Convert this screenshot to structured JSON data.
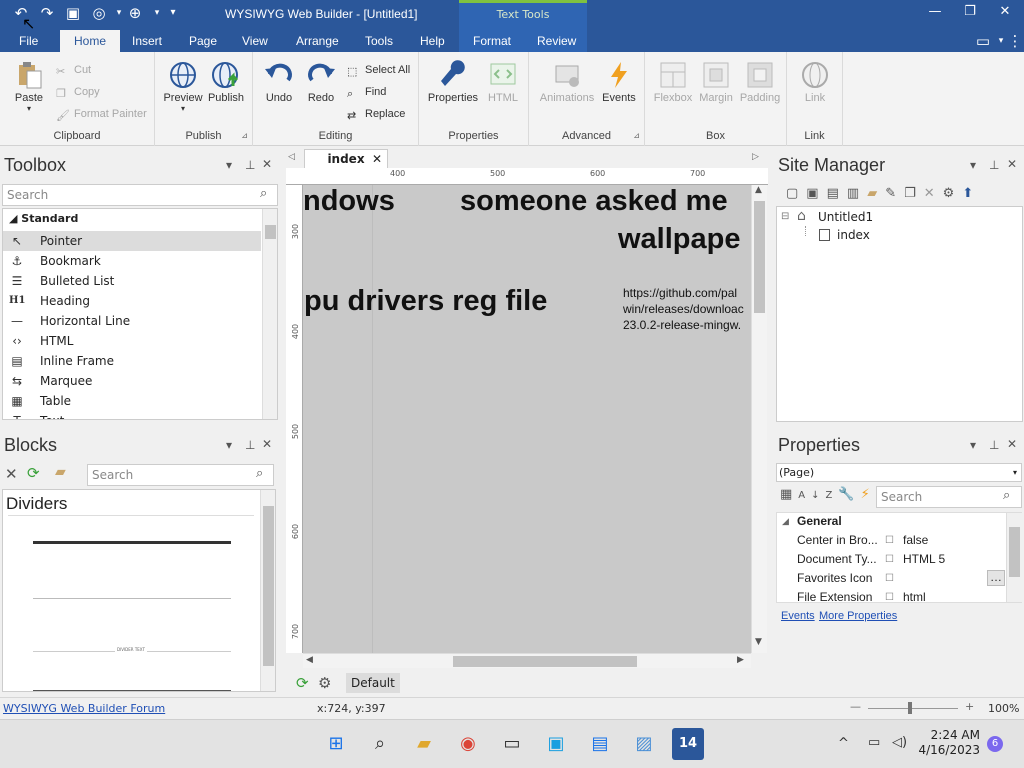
{
  "window": {
    "title": "WYSIWYG Web Builder - [Untitled1]",
    "context_tab": "Text Tools"
  },
  "tabs": [
    "File",
    "Home",
    "Insert",
    "Page",
    "View",
    "Arrange",
    "Tools",
    "Help",
    "Format",
    "Review"
  ],
  "ribbon": {
    "clipboard": {
      "label": "Clipboard",
      "paste": "Paste",
      "cut": "Cut",
      "copy": "Copy",
      "format_painter": "Format Painter"
    },
    "publish": {
      "label": "Publish",
      "preview": "Preview",
      "publish": "Publish"
    },
    "editing": {
      "label": "Editing",
      "undo": "Undo",
      "redo": "Redo",
      "select_all": "Select All",
      "find": "Find",
      "replace": "Replace"
    },
    "properties": {
      "label": "Properties",
      "properties": "Properties",
      "html": "HTML"
    },
    "advanced": {
      "label": "Advanced",
      "animations": "Animations",
      "events": "Events"
    },
    "box": {
      "label": "Box",
      "flexbox": "Flexbox",
      "margin": "Margin",
      "padding": "Padding"
    },
    "link": {
      "label": "Link",
      "link": "Link"
    }
  },
  "toolbox": {
    "title": "Toolbox",
    "search_placeholder": "Search",
    "category": "Standard",
    "items": [
      "Pointer",
      "Bookmark",
      "Bulleted List",
      "Heading",
      "Horizontal Line",
      "HTML",
      "Inline Frame",
      "Marquee",
      "Table",
      "Text"
    ]
  },
  "blocks": {
    "title": "Blocks",
    "search_placeholder": "Search",
    "category": "Dividers",
    "divider_caption": "DIVIDER TEXT"
  },
  "document_tab": "index",
  "rulers": {
    "top": [
      "400",
      "500",
      "600",
      "700"
    ],
    "left": [
      "300",
      "400",
      "500",
      "600",
      "700"
    ]
  },
  "canvas": {
    "text1": "ndows",
    "text2": "someone asked me",
    "text3": "wallpape",
    "text4": "pu drivers reg file",
    "link_lines": [
      "https://github.com/pal",
      "win/releases/downloac",
      "23.0.2-release-mingw."
    ]
  },
  "bottom_bar": {
    "default_label": "Default"
  },
  "site_manager": {
    "title": "Site Manager",
    "root": "Untitled1",
    "page": "index"
  },
  "properties_panel": {
    "title": "Properties",
    "selector": "(Page)",
    "search_placeholder": "Search",
    "group": "General",
    "rows": [
      {
        "name": "Center in Bro...",
        "value": "false"
      },
      {
        "name": "Document Ty...",
        "value": "HTML 5"
      },
      {
        "name": "Favorites Icon",
        "value": ""
      },
      {
        "name": "File Extension",
        "value": "html"
      }
    ],
    "events_link": "Events",
    "more_link": "More Properties"
  },
  "status": {
    "forum_link": "WYSIWYG Web Builder Forum",
    "coords": "x:724, y:397",
    "zoom": "100%"
  },
  "taskbar": {
    "time": "2:24 AM",
    "date": "4/16/2023",
    "badge": "6"
  },
  "colors": {
    "accent": "#2b579a",
    "link": "#1f4fb5"
  }
}
